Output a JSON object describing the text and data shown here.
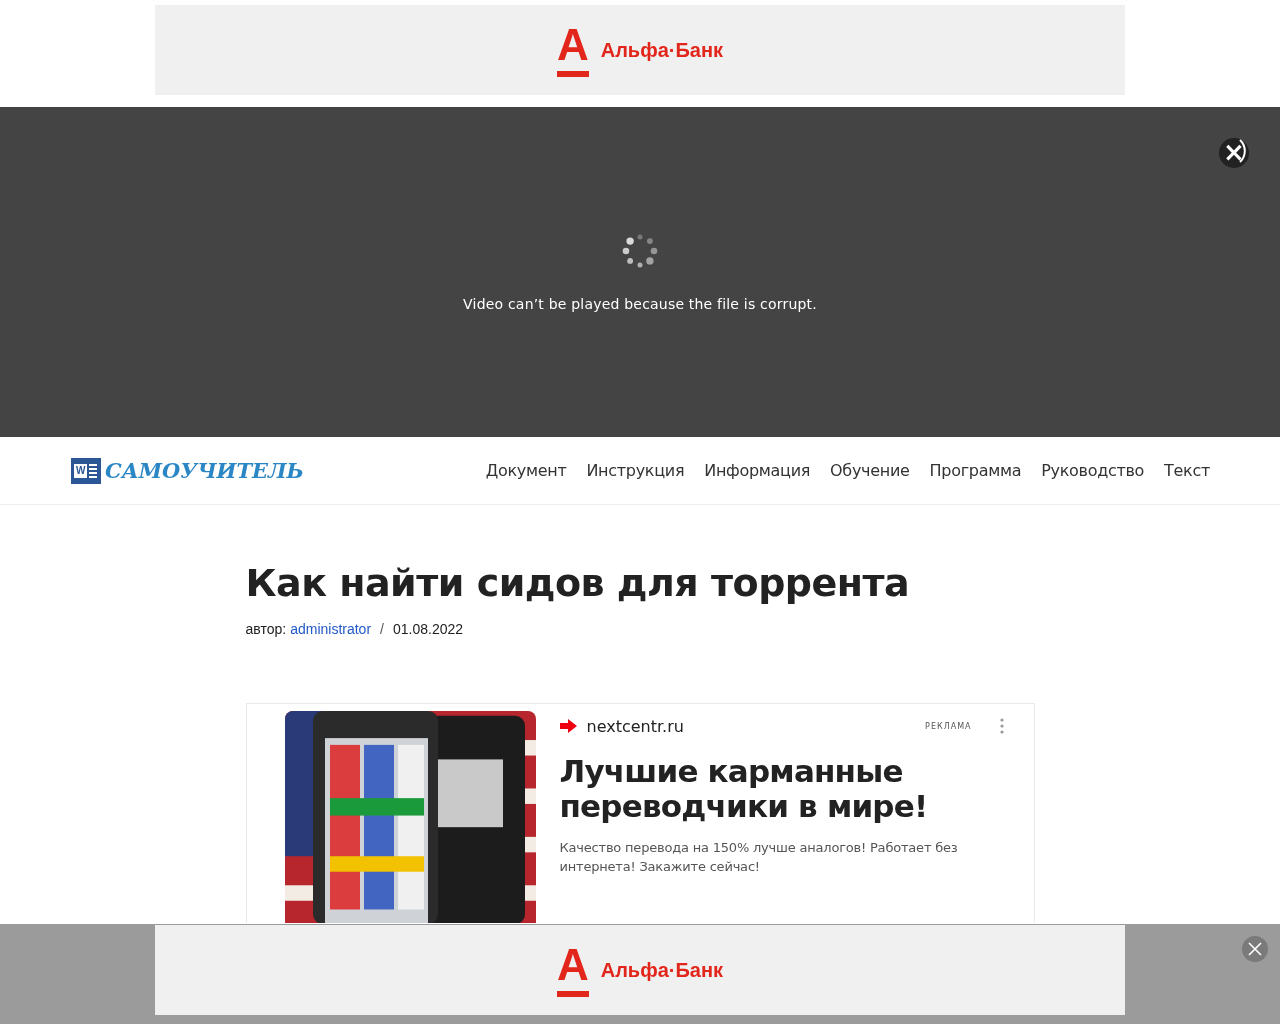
{
  "top_banner": {
    "mark": "А",
    "name": "Альфа·Банк"
  },
  "video": {
    "message": "Video can’t be played because the file is corrupt.",
    "close": "×"
  },
  "header": {
    "logo": {
      "icon_letter": "W",
      "text": "САМОУЧИТЕЛЬ"
    },
    "nav": [
      {
        "label": "Документ"
      },
      {
        "label": "Инструкция"
      },
      {
        "label": "Информация"
      },
      {
        "label": "Обучение"
      },
      {
        "label": "Программа"
      },
      {
        "label": "Руководство"
      },
      {
        "label": "Текст"
      }
    ]
  },
  "article": {
    "title": "Как найти сидов для торрента",
    "author_label": "автор:",
    "author": "administrator",
    "separator": "/",
    "date": "01.08.2022"
  },
  "ad": {
    "domain": "nextcentr.ru",
    "label": "РЕКЛАМА",
    "title": "Лучшие карманные переводчики в мире!",
    "text": "Качество перевода на 150% лучше аналогов! Работает без интернета! Закажите сейчас!"
  },
  "bottom_banner": {
    "mark": "А",
    "name": "Альфа·Банк"
  }
}
